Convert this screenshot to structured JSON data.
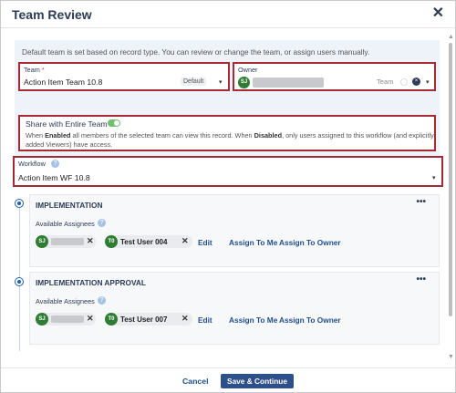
{
  "dialog": {
    "title": "Team Review",
    "close_glyph": "✕"
  },
  "info": {
    "text": "Default team is set based on record type. You can review or change the team, or assign users manually."
  },
  "team": {
    "label": "Team",
    "required_mark": "*",
    "value": "Action Item Team 10.8",
    "default_badge": "Default",
    "caret": "▾"
  },
  "owner": {
    "label": "Owner",
    "initials": "SJ",
    "team_label": "Team",
    "clear_glyph": "×",
    "caret": "▾"
  },
  "share": {
    "label": "Share with Entire Team",
    "enabled": true,
    "desc_1": "When ",
    "desc_enabled": "Enabled",
    "desc_2": " all members of the selected team can view this record. When ",
    "desc_disabled": "Disabled",
    "desc_3": ", only users assigned to this workflow (and explicitly added Viewers) have access."
  },
  "workflow": {
    "label": "Workflow",
    "info_glyph": "?",
    "value": "Action Item WF 10.8",
    "caret": "▾"
  },
  "steps": [
    {
      "title": "IMPLEMENTATION",
      "more": "•••",
      "available_label": "Available Assignees",
      "info_glyph": "?",
      "assignee_1_initials": "SJ",
      "assignee_2_initials": "T0",
      "assignee_2_name": "Test User 004",
      "remove_glyph": "✕",
      "edit": "Edit",
      "assign_to_me": "Assign To Me",
      "assign_to_owner": "Assign To Owner"
    },
    {
      "title": "IMPLEMENTATION APPROVAL",
      "more": "•••",
      "available_label": "Available Assignees",
      "info_glyph": "?",
      "assignee_1_initials": "SJ",
      "assignee_2_initials": "T0",
      "assignee_2_name": "Test User 007",
      "remove_glyph": "✕",
      "edit": "Edit",
      "assign_to_me": "Assign To Me",
      "assign_to_owner": "Assign To Owner"
    }
  ],
  "footer": {
    "cancel": "Cancel",
    "save": "Save & Continue"
  },
  "scroll": {
    "up": "▲",
    "down": "▼"
  },
  "colors": {
    "accent": "#2d4f8a",
    "highlight_border": "#a52a36",
    "avatar": "#2e7d32",
    "panel_bg": "#eef3f9"
  }
}
